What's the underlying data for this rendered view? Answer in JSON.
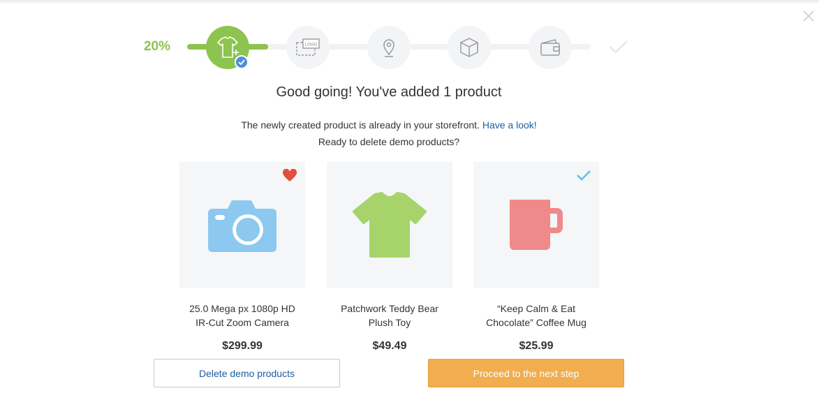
{
  "progress": {
    "percent_label": "20%",
    "percent": 20,
    "steps": [
      {
        "name": "add-product",
        "icon": "tshirt-plus-icon",
        "state": "completed"
      },
      {
        "name": "add-logo",
        "icon": "logo-icon",
        "logo_text": "LOGO",
        "state": "pending"
      },
      {
        "name": "set-location",
        "icon": "map-pin-icon",
        "state": "pending"
      },
      {
        "name": "shipping",
        "icon": "box-icon",
        "state": "pending"
      },
      {
        "name": "payment",
        "icon": "wallet-icon",
        "state": "pending"
      },
      {
        "name": "finish",
        "icon": "check-icon",
        "state": "pending"
      }
    ]
  },
  "header": {
    "title": "Good going! You've added 1 product",
    "line1": "The newly created product is already in your storefront.",
    "link": "Have a look!",
    "line2": "Ready to delete demo products?"
  },
  "products": [
    {
      "name_line1": "25.0 Mega px 1080p HD",
      "name_line2": "IR-Cut Zoom Camera",
      "price": "$299.99",
      "icon": "camera-icon",
      "badge": "heart-icon"
    },
    {
      "name_line1": "Patchwork Teddy Bear",
      "name_line2": "Plush Toy",
      "price": "$49.49",
      "icon": "tshirt-icon",
      "badge": ""
    },
    {
      "name_line1": "“Keep Calm & Eat",
      "name_line2": "Chocolate” Coffee Mug",
      "price": "$25.99",
      "icon": "mug-icon",
      "badge": "check-icon"
    }
  ],
  "actions": {
    "delete_label": "Delete demo products",
    "next_label": "Proceed to the next step"
  },
  "colors": {
    "accent_green": "#8dc34f",
    "link_blue": "#1d5c9e",
    "button_orange": "#f1ad4e",
    "camera_blue": "#8cc8ef",
    "tshirt_green": "#a6d46b",
    "mug_red": "#f08a8a",
    "heart_red": "#e0503e",
    "check_blue": "#5bbde8"
  }
}
